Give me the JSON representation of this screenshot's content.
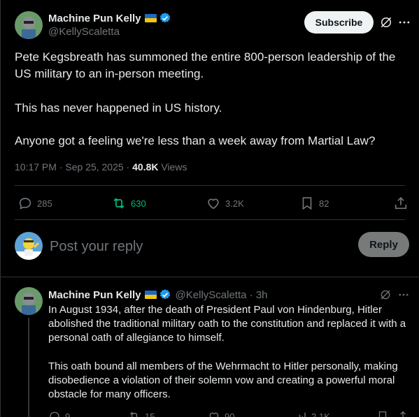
{
  "main_tweet": {
    "author_name": "Machine Pun Kelly",
    "handle": "@KellyScaletta",
    "subscribe_label": "Subscribe",
    "paragraphs": [
      "Pete Kegsbreath has summoned the entire 800-person leadership of the US military to an in-person meeting.",
      "This has never happened in US history.",
      "Anyone got a feeling we're less than a week away from Martial Law?"
    ],
    "timestamp": "10:17 PM · Sep 25, 2025 · ",
    "views_count": "40.8K",
    "views_label": " Views",
    "actions": {
      "replies": "285",
      "reposts": "630",
      "likes": "3.2K",
      "bookmarks": "82"
    }
  },
  "composer": {
    "placeholder": "Post your reply",
    "reply_label": "Reply"
  },
  "reply_tweet": {
    "author_name": "Machine Pun Kelly",
    "handle_time": "@KellyScaletta · 3h",
    "paragraphs": [
      "In August 1934, after the death of President Paul von Hindenburg, Hitler abolished the traditional military oath to the constitution and replaced it with a personal oath of allegiance to himself.",
      "This oath bound all members of the Wehrmacht to Hitler personally, making disobedience a violation of their solemn vow and creating a powerful moral obstacle for many officers."
    ],
    "actions": {
      "replies": "9",
      "reposts": "15",
      "likes": "90",
      "views": "2.1K"
    }
  },
  "colors": {
    "background": "#000000",
    "text": "#e7e9ea",
    "muted": "#71767b",
    "repost_active": "#00ba7c",
    "verified": "#1d9bf0",
    "divider": "#2f3336"
  },
  "icons": [
    "reply-icon",
    "repost-icon",
    "like-icon",
    "bookmark-icon",
    "share-icon",
    "grok-icon",
    "more-icon",
    "verified-badge-icon",
    "ukraine-flag-icon",
    "views-icon"
  ]
}
